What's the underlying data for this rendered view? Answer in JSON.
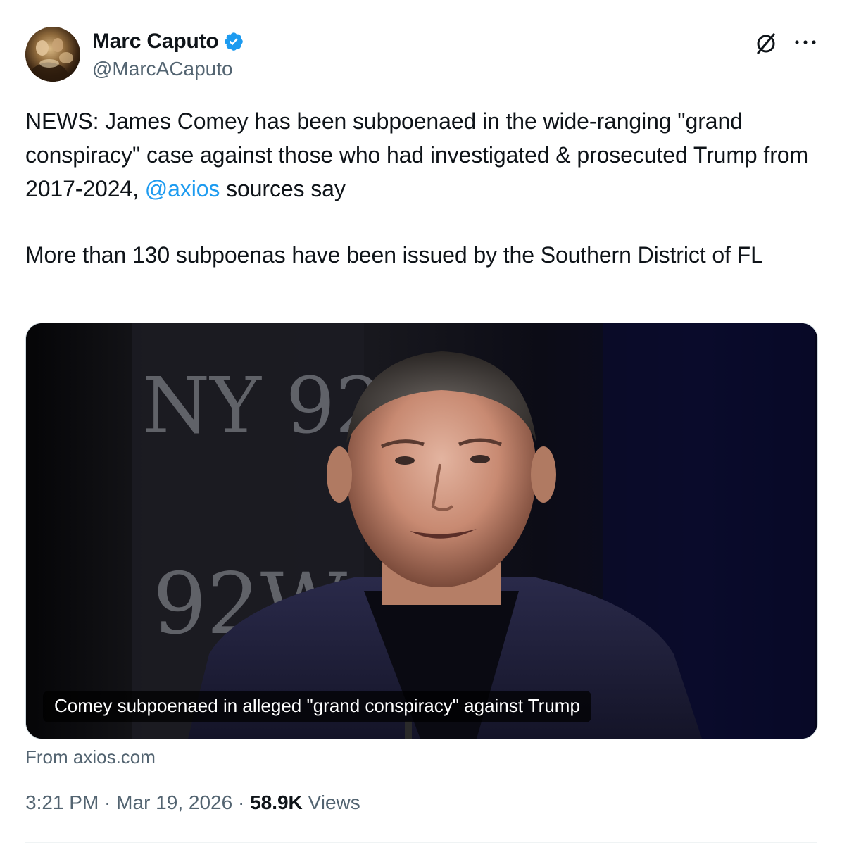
{
  "author": {
    "name": "Marc Caputo",
    "handle": "@MarcACaputo",
    "verified": true,
    "avatar_icon": "avatar-painting",
    "verified_color": "#1d9bf0"
  },
  "header_actions": {
    "grok_icon": "grok-icon",
    "more_icon": "more-icon"
  },
  "tweet": {
    "text_part1": "NEWS: James Comey has been subpoenaed in the wide-ranging \"grand conspiracy\" case against those who had investigated & prosecuted Trump from 2017-2024, ",
    "mention": "@axios",
    "text_part2": " sources say",
    "paragraph2": "More than 130 subpoenas have been issued by the Southern District of FL"
  },
  "card": {
    "caption": "Comey subpoenaed in alleged \"grand conspiracy\" against Trump",
    "source": "From axios.com"
  },
  "meta": {
    "time": "3:21 PM",
    "separator": " · ",
    "date": "Mar 19, 2026",
    "views_count": "58.9K",
    "views_label": " Views"
  },
  "colors": {
    "text": "#0f1419",
    "secondary": "#536471",
    "link": "#1d9bf0",
    "border": "#cfd9de"
  }
}
